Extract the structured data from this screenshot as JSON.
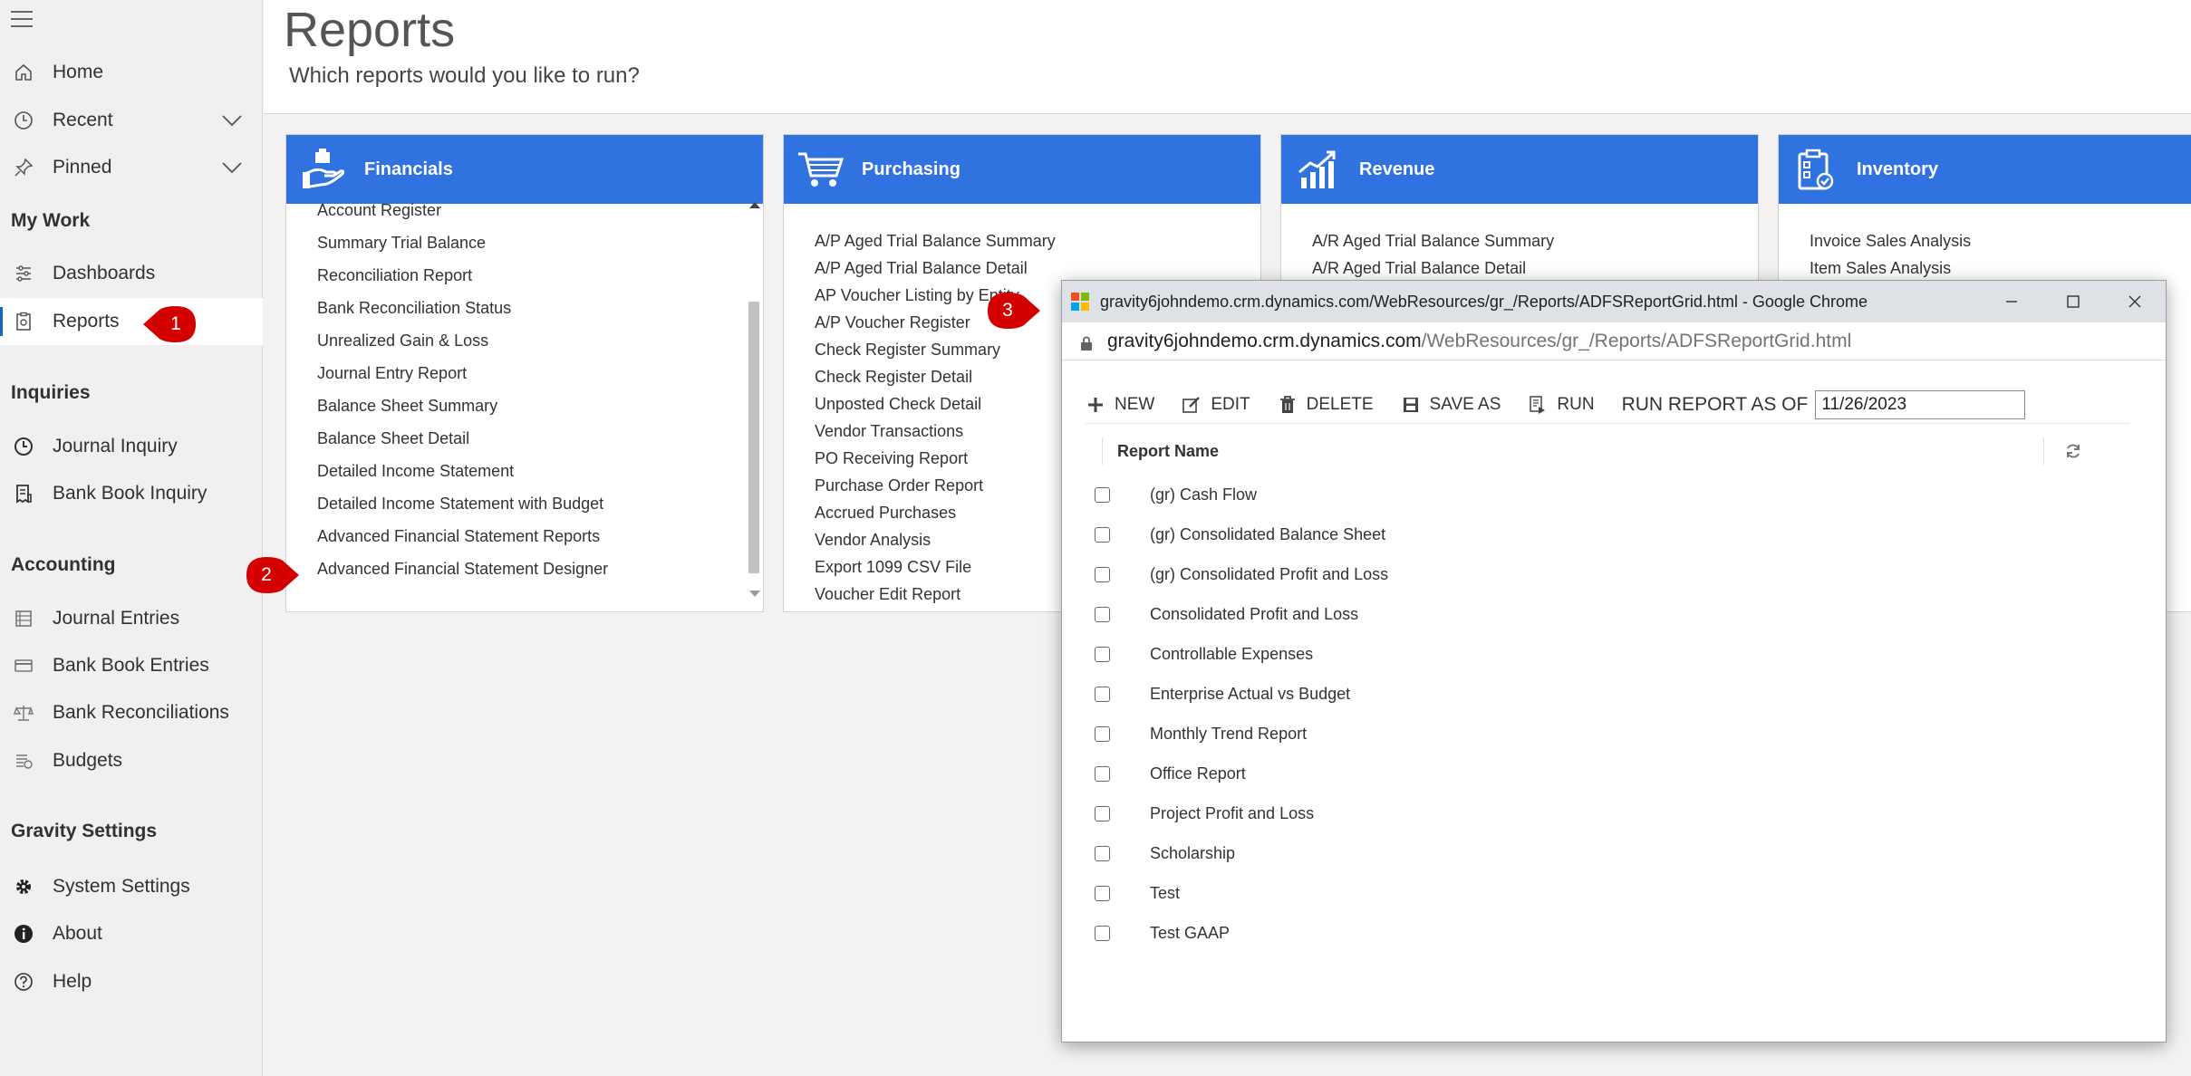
{
  "sidebar": {
    "nav": [
      {
        "label": "Home",
        "icon": "home-icon"
      },
      {
        "label": "Recent",
        "icon": "clock-icon"
      },
      {
        "label": "Pinned",
        "icon": "pin-icon"
      }
    ],
    "my_work_title": "My Work",
    "my_work": [
      {
        "label": "Dashboards",
        "icon": "dashboard-icon"
      },
      {
        "label": "Reports",
        "icon": "report-icon"
      }
    ],
    "inquiries_title": "Inquiries",
    "inquiries": [
      {
        "label": "Journal Inquiry",
        "icon": "clock-icon"
      },
      {
        "label": "Bank Book Inquiry",
        "icon": "receipt-icon"
      }
    ],
    "accounting_title": "Accounting",
    "accounting": [
      {
        "label": "Journal Entries",
        "icon": "ledger-icon"
      },
      {
        "label": "Bank Book Entries",
        "icon": "card-icon"
      },
      {
        "label": "Bank Reconciliations",
        "icon": "scale-icon"
      },
      {
        "label": "Budgets",
        "icon": "budget-icon"
      }
    ],
    "gravity_title": "Gravity Settings",
    "gravity": [
      {
        "label": "System Settings",
        "icon": "gear-icon"
      },
      {
        "label": "About",
        "icon": "info-icon"
      },
      {
        "label": "Help",
        "icon": "help-icon"
      }
    ]
  },
  "header": {
    "title": "Reports",
    "subtitle": "Which reports would you like to run?"
  },
  "cards": {
    "financials": {
      "title": "Financials",
      "items": [
        "Account Register",
        "Summary Trial Balance",
        "Reconciliation Report",
        "Bank Reconciliation Status",
        "Unrealized Gain & Loss",
        "Journal Entry Report",
        "Balance Sheet Summary",
        "Balance Sheet Detail",
        "Detailed Income Statement",
        "Detailed Income Statement with Budget",
        "Advanced Financial Statement Reports",
        "Advanced Financial Statement Designer"
      ]
    },
    "purchasing": {
      "title": "Purchasing",
      "items": [
        "A/P Aged Trial Balance Summary",
        "A/P Aged Trial Balance Detail",
        "AP Voucher Listing by Entity",
        "A/P Voucher Register",
        "Check Register Summary",
        "Check Register Detail",
        "Unposted Check Detail",
        "Vendor Transactions",
        "PO Receiving Report",
        "Purchase Order Report",
        "Accrued Purchases",
        "Vendor Analysis",
        "Export 1099 CSV File",
        "Voucher Edit Report"
      ]
    },
    "revenue": {
      "title": "Revenue",
      "items": [
        "A/R Aged Trial Balance Summary",
        "A/R Aged Trial Balance Detail"
      ]
    },
    "inventory": {
      "title": "Inventory",
      "items": [
        "Invoice Sales Analysis",
        "Item Sales Analysis"
      ]
    }
  },
  "badges": [
    "1",
    "2",
    "3"
  ],
  "popup": {
    "window_title": "gravity6johndemo.crm.dynamics.com/WebResources/gr_/Reports/ADFSReportGrid.html - Google Chrome",
    "url_host": "gravity6johndemo.crm.dynamics.com",
    "url_path": "/WebResources/gr_/Reports/ADFSReportGrid.html",
    "toolbar": {
      "new": "NEW",
      "edit": "EDIT",
      "delete": "DELETE",
      "save_as": "SAVE AS",
      "run": "RUN",
      "run_as_of": "RUN REPORT AS OF",
      "date": "11/26/2023"
    },
    "column_header": "Report Name",
    "rows": [
      "(gr) Cash Flow",
      "(gr) Consolidated Balance Sheet",
      "(gr) Consolidated Profit and Loss",
      "Consolidated Profit and Loss",
      "Controllable Expenses",
      "Enterprise Actual vs Budget",
      "Monthly Trend Report",
      "Office Report",
      "Project Profit and Loss",
      "Scholarship",
      "Test",
      "Test GAAP"
    ]
  },
  "colors": {
    "card_header": "#2f72e0",
    "badge": "#d40000",
    "accent": "#0f6cbd"
  }
}
